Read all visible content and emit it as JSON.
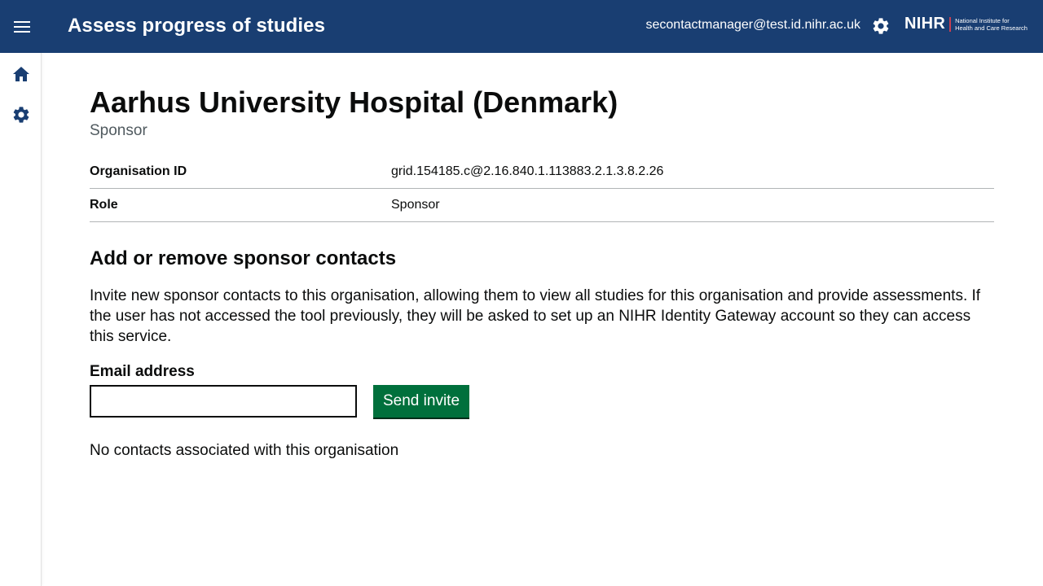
{
  "header": {
    "menu_icon": "menu-icon",
    "title": "Assess progress of studies",
    "user_email": "secontactmanager@test.id.nihr.ac.uk",
    "settings_icon": "gear-icon",
    "logo_text": "NIHR",
    "logo_subtitle": "National Institute for\nHealth and Care Research"
  },
  "sidebar": {
    "items": [
      {
        "icon": "home-icon"
      },
      {
        "icon": "gear-icon"
      }
    ]
  },
  "main": {
    "org_name": "Aarhus University Hospital (Denmark)",
    "caption": "Sponsor",
    "summary": [
      {
        "key": "Organisation ID",
        "value": "grid.154185.c@2.16.840.1.113883.2.1.3.8.2.26"
      },
      {
        "key": "Role",
        "value": "Sponsor"
      }
    ],
    "section_heading": "Add or remove sponsor contacts",
    "intro": "Invite new sponsor contacts to this organisation, allowing them to view all studies for this organisation and provide assessments. If the user has not accessed the tool previously, they will be asked to set up an NIHR Identity Gateway account so they can access this service.",
    "email_label": "Email address",
    "email_value": "",
    "send_label": "Send invite",
    "no_contacts": "No contacts associated with this organisation"
  },
  "colors": {
    "header_bg": "#193e72",
    "primary_button": "#00703c",
    "sidebar_icon": "#193e72",
    "logo_accent": "#c63f52"
  }
}
